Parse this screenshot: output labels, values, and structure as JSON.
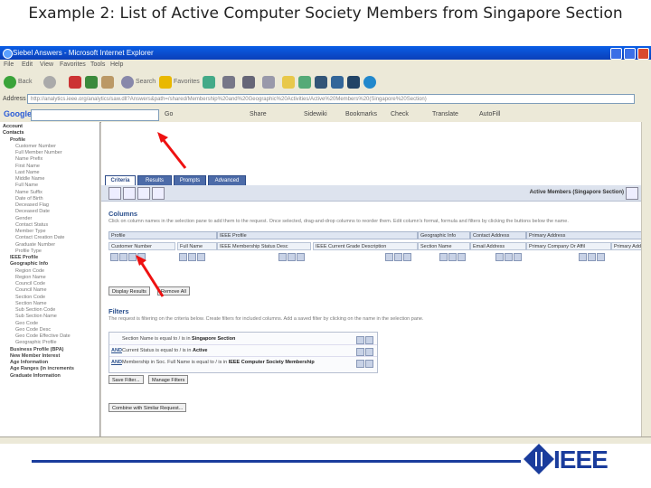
{
  "slide": {
    "title": "Example 2: List of Active Computer Society Members from Singapore Section"
  },
  "browser": {
    "title": "Siebel Answers - Microsoft Internet Explorer",
    "menu": [
      "File",
      "Edit",
      "View",
      "Favorites",
      "Tools",
      "Help"
    ],
    "toolbar": {
      "back": "Back",
      "search": "Search",
      "favorites": "Favorites"
    },
    "address_label": "Address",
    "address_value": "http://analytics.ieee.org/analytics/saw.dll?Answers&path=/shared/Membership%20and%20Geographic%20Activities/Active%20Members%20(Singapore%20Section)",
    "google_label": "Google",
    "google_items": [
      "Go",
      "Share",
      "Sidewiki",
      "Bookmarks",
      "Check",
      "Translate",
      "AutoFill"
    ]
  },
  "left_tree": [
    {
      "text": "Account",
      "kind": "cat"
    },
    {
      "text": "Contacts",
      "kind": "cat"
    },
    {
      "text": "Profile",
      "kind": "sub"
    },
    {
      "text": "Customer Number",
      "kind": "leaf"
    },
    {
      "text": "Full Member Number",
      "kind": "leaf"
    },
    {
      "text": "Name Prefix",
      "kind": "leaf"
    },
    {
      "text": "First Name",
      "kind": "leaf"
    },
    {
      "text": "Last Name",
      "kind": "leaf"
    },
    {
      "text": "Middle Name",
      "kind": "leaf"
    },
    {
      "text": "Full Name",
      "kind": "leaf"
    },
    {
      "text": "Name Suffix",
      "kind": "leaf"
    },
    {
      "text": "Date of Birth",
      "kind": "leaf"
    },
    {
      "text": "Deceased Flag",
      "kind": "leaf"
    },
    {
      "text": "Deceased Date",
      "kind": "leaf"
    },
    {
      "text": "Gender",
      "kind": "leaf"
    },
    {
      "text": "Contact Status",
      "kind": "leaf"
    },
    {
      "text": "Member Type",
      "kind": "leaf"
    },
    {
      "text": "Contact Creation Date",
      "kind": "leaf"
    },
    {
      "text": "Graduate Number",
      "kind": "leaf"
    },
    {
      "text": "Profile Type",
      "kind": "leaf"
    },
    {
      "text": "IEEE Profile",
      "kind": "sub"
    },
    {
      "text": "Geographic Info",
      "kind": "sub"
    },
    {
      "text": "Region Code",
      "kind": "leaf"
    },
    {
      "text": "Region Name",
      "kind": "leaf"
    },
    {
      "text": "Council Code",
      "kind": "leaf"
    },
    {
      "text": "Council Name",
      "kind": "leaf"
    },
    {
      "text": "Section Code",
      "kind": "leaf"
    },
    {
      "text": "Section Name",
      "kind": "leaf"
    },
    {
      "text": "Sub Section Code",
      "kind": "leaf"
    },
    {
      "text": "Sub Section Name",
      "kind": "leaf"
    },
    {
      "text": "Geo Code",
      "kind": "leaf"
    },
    {
      "text": "Geo Code Desc",
      "kind": "leaf"
    },
    {
      "text": "Geo Code Effective Date",
      "kind": "leaf"
    },
    {
      "text": "Geographic Profile",
      "kind": "leaf"
    },
    {
      "text": "Business Profile (BPA)",
      "kind": "sub"
    },
    {
      "text": "New Member Interest",
      "kind": "sub"
    },
    {
      "text": "Age Information",
      "kind": "sub"
    },
    {
      "text": "Age Ranges (in increments",
      "kind": "sub"
    },
    {
      "text": "Graduate Information",
      "kind": "sub"
    }
  ],
  "tabs": [
    "Criteria",
    "Results",
    "Prompts",
    "Advanced"
  ],
  "subject_title": "Active Members (Singapore Section)",
  "columns_section": {
    "title": "Columns",
    "description": "Click on column names in the selection pane to add them to the request. Once selected, drag-and-drop columns to reorder them. Edit column's format, formula and filters by clicking the buttons below the name."
  },
  "groups": [
    "Profile",
    "IEEE Profile",
    "Geographic Info",
    "Contact Address",
    "Primary Address"
  ],
  "columns": [
    "Customer Number",
    "Full Name",
    "IEEE Membership Status Desc",
    "IEEE Current Grade Description",
    "Section Name",
    "Email Address",
    "Primary Company Or Affil",
    "Primary Addr"
  ],
  "buttons": {
    "display_results": "Display Results",
    "remove_all": "Remove All",
    "save_filter": "Save Filter...",
    "manage_filters": "Manage Filters",
    "combine": "Combine with Similar Request..."
  },
  "filters_section": {
    "title": "Filters",
    "description": "The request is filtering on the criteria below. Create filters for included columns. Add a saved filter by clicking on the name in the selection pane."
  },
  "filters": [
    {
      "op": "",
      "text": "Section Name is equal to / is in ",
      "value": "Singapore Section"
    },
    {
      "op": "AND",
      "text": "Current Status is equal to / is in ",
      "value": "Active"
    },
    {
      "op": "AND",
      "text": "Membership in Soc. Full Name is equal to / is in ",
      "value": "IEEE Computer Society Membership"
    }
  ],
  "logo": {
    "text": "IEEE"
  },
  "colors": {
    "accent": "#1a3c9c",
    "tab": "#4c6ba8",
    "arrow": "#e11"
  }
}
